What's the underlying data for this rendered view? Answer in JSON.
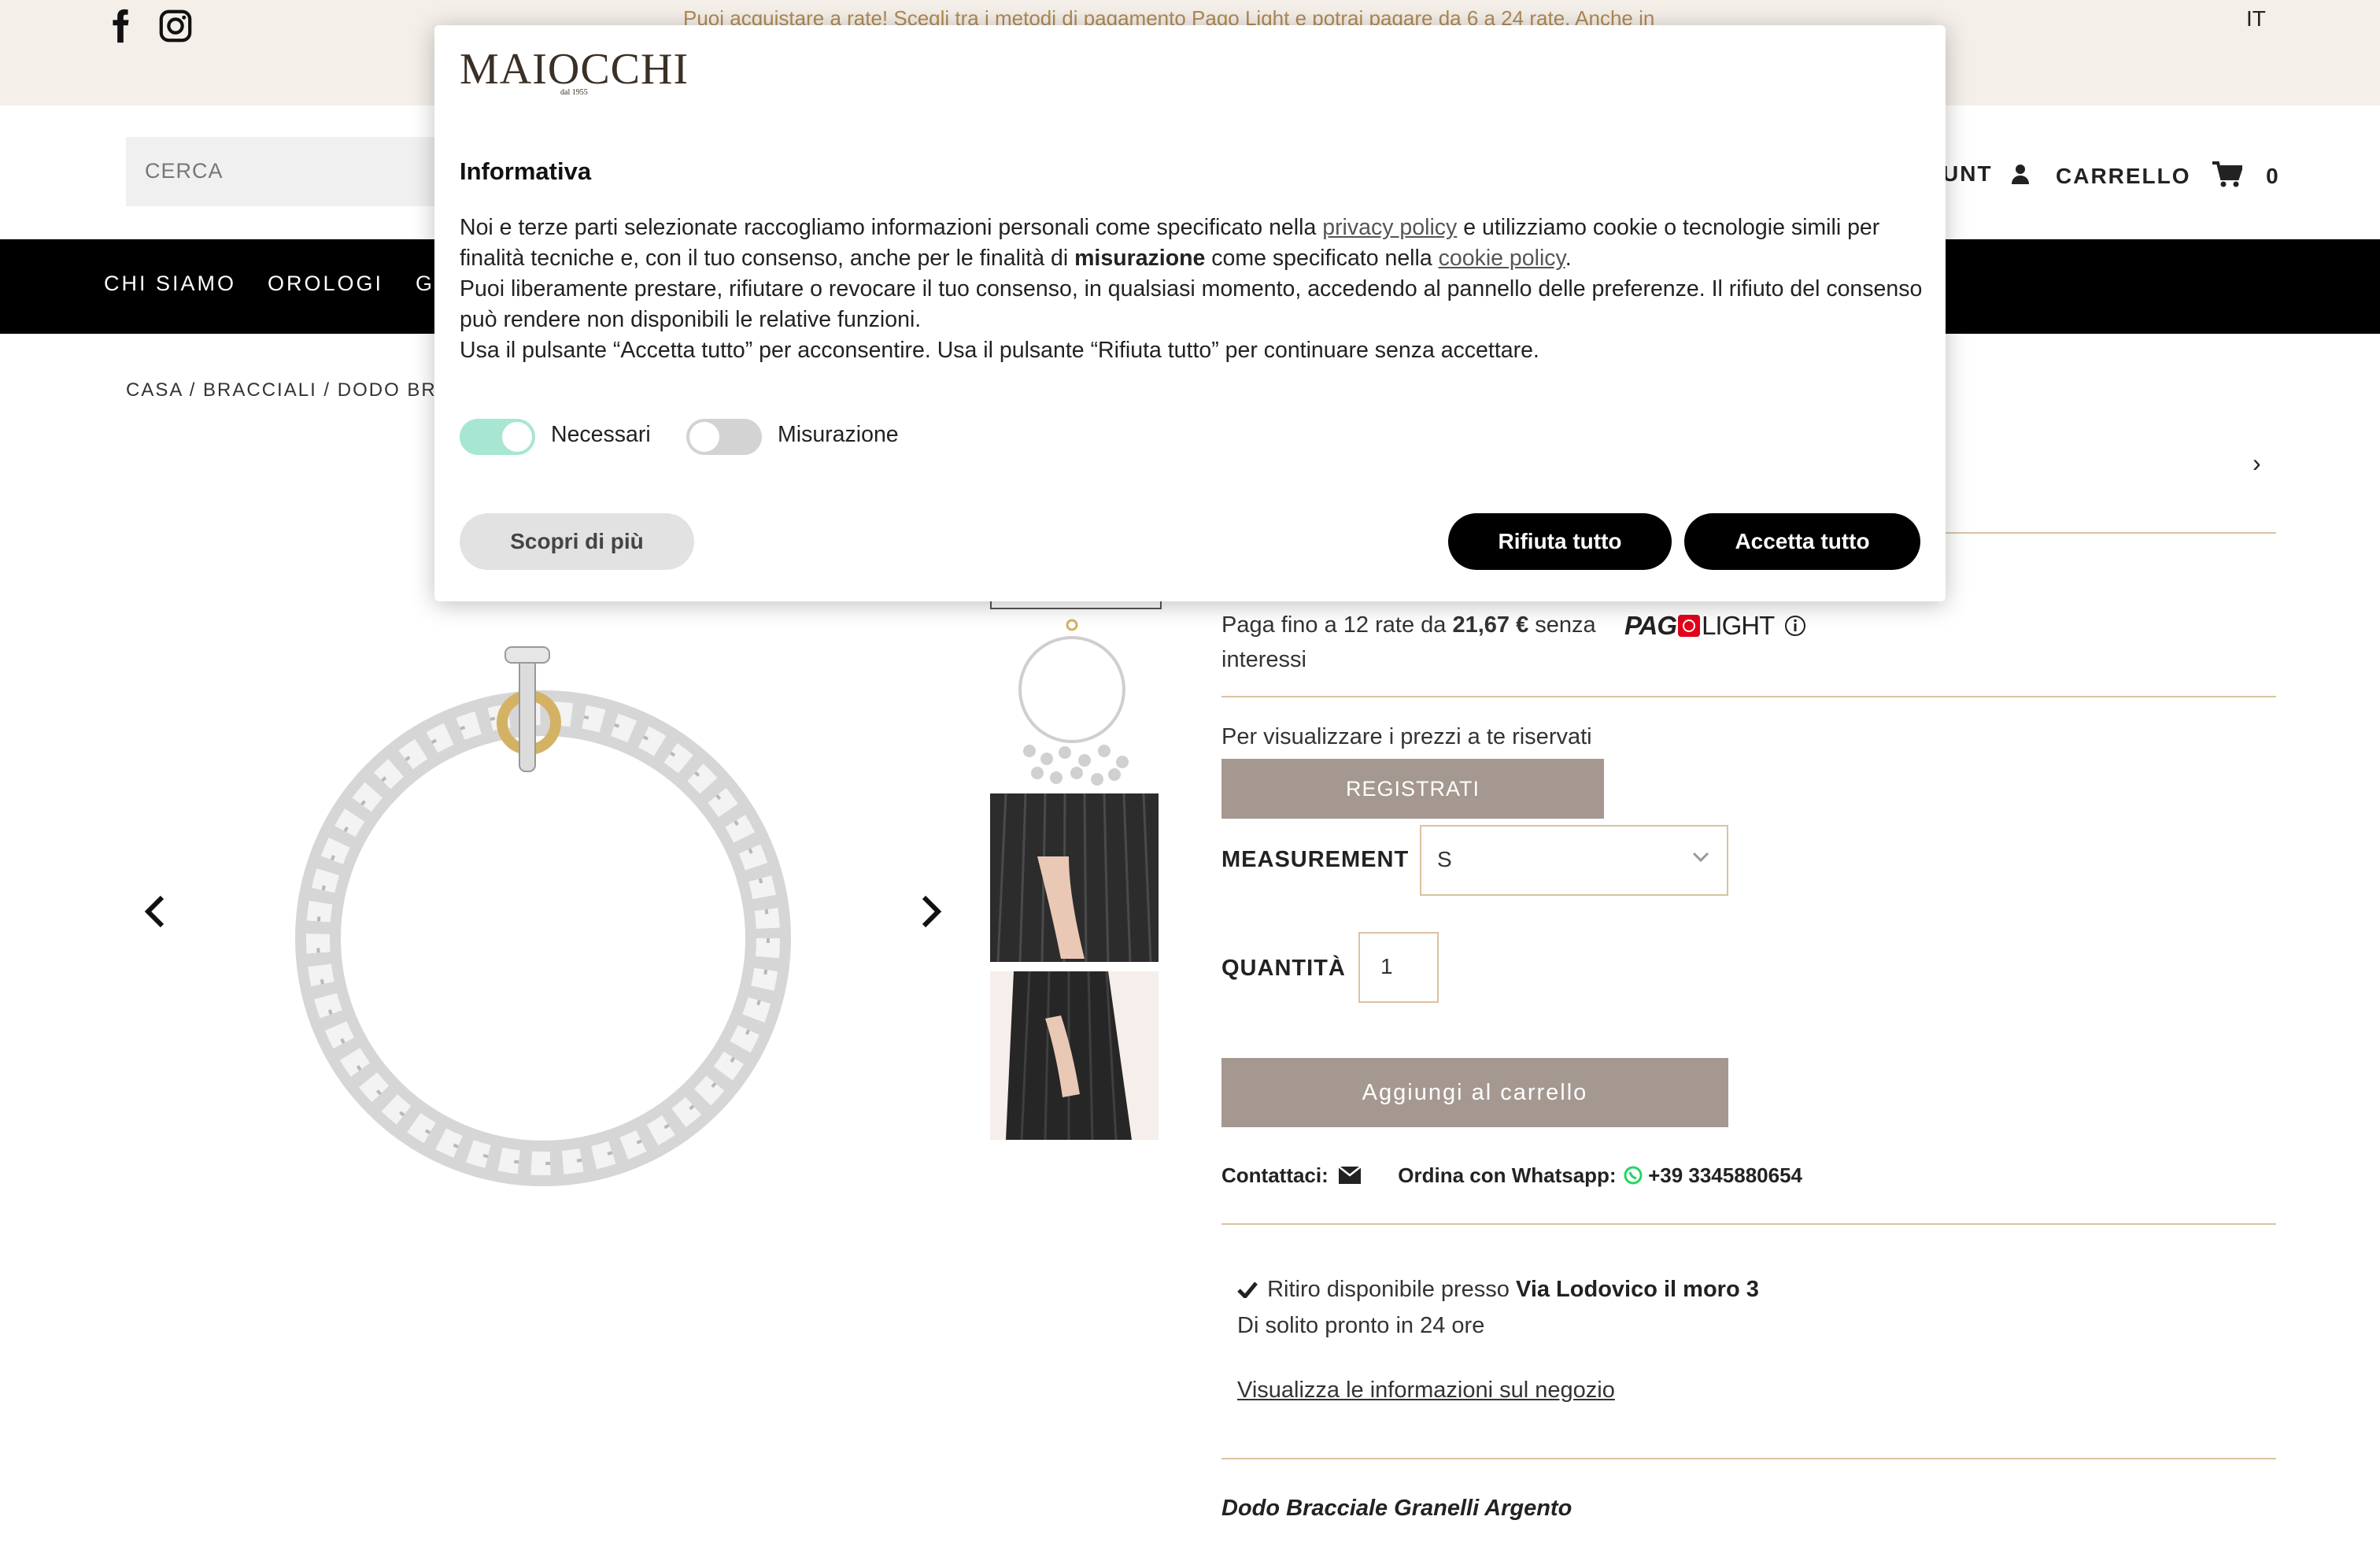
{
  "announcement": {
    "text": "Puoi acquistare a rate! Scegli tra i metodi di pagamento Pago Light e potrai pagare da 6 a 24  rate. Anche in",
    "language": "IT"
  },
  "social": {
    "facebook_icon": "facebook-icon",
    "instagram_icon": "instagram-icon"
  },
  "header": {
    "search_placeholder": "CERCA",
    "account_label": "UNT",
    "cart_label": "CARRELLO",
    "cart_count": "0"
  },
  "nav": {
    "items": [
      "CHI SIAMO",
      "OROLOGI",
      "G"
    ]
  },
  "breadcrumb": "CASA / BRACCIALI / DODO BRA",
  "gallery": {
    "prev_icon": "chevron-left-icon",
    "next_icon": "chevron-right-icon",
    "side_arrow": "›"
  },
  "product": {
    "installments_prefix": "Paga fino a 12 rate da",
    "installments_amount": "21,67 €",
    "installments_suffix": "senza",
    "installments_line2": "interessi",
    "pago_logo_left": "PAG",
    "pago_logo_right": "LIGHT",
    "reserved_text": "Per visualizzare i prezzi a te riservati",
    "register_label": "REGISTRATI",
    "measurement_label": "MEASUREMENT",
    "measurement_value": "S",
    "quantity_label": "QUANTITÀ",
    "quantity_value": "1",
    "add_to_cart_label": "Aggiungi al carrello",
    "contact_label": "Contattaci:",
    "whatsapp_label": "Ordina con Whatsapp:",
    "whatsapp_number": "+39 3345880654",
    "pickup_prefix": "Ritiro disponibile presso",
    "pickup_location": "Via Lodovico il moro 3",
    "pickup_time": "Di solito pronto in 24 ore",
    "store_info_link": "Visualizza le informazioni sul negozio",
    "description_title": "Dodo Bracciale Granelli Argento"
  },
  "cookie_modal": {
    "logo_text": "MAIOCCHI",
    "logo_sub": "dal 1955",
    "title": "Informativa",
    "p1_a": "Noi e terze parti selezionate raccogliamo informazioni personali come specificato nella",
    "p1_link1": "privacy policy",
    "p1_b": "e utilizziamo cookie o tecnologie simili per",
    "p1_c": "finalità tecniche e, con il tuo consenso, anche per le finalità di",
    "p1_bold": "misurazione",
    "p1_d": "come specificato nella",
    "p1_link2": "cookie policy",
    "p1_e": ".",
    "p2_a": "Puoi liberamente prestare, rifiutare o revocare il tuo consenso, in qualsiasi momento, accedendo al pannello delle preferenze. Il rifiuto del consenso",
    "p2_b": "può rendere non disponibili le relative funzioni.",
    "p3": "Usa il pulsante “Accetta tutto” per acconsentire. Usa il pulsante “Rifiuta tutto” per continuare senza accettare.",
    "toggle_necessary_label": "Necessari",
    "toggle_necessary_on": true,
    "toggle_measure_label": "Misurazione",
    "toggle_measure_on": false,
    "learn_more_label": "Scopri di più",
    "reject_label": "Rifiuta tutto",
    "accept_label": "Accetta tutto"
  },
  "colors": {
    "announcement_bg": "#f4efe9",
    "announcement_text": "#b08a54",
    "nav_bg": "#000000",
    "accent_line": "#d9c3a1",
    "button_taupe": "#a59891",
    "toggle_on": "#a8e6d4",
    "whatsapp_green": "#25d366"
  }
}
